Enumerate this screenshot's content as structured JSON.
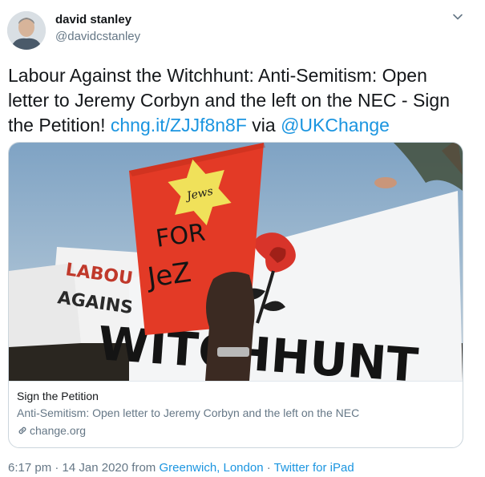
{
  "user": {
    "name": "david stanley",
    "handle": "@davidcstanley"
  },
  "tweet": {
    "text_plain": "Labour Against the Witchhunt: Anti-Semitism: Open letter to Jeremy Corbyn and the left on the NEC - Sign the Petition!",
    "link": "chng.it/ZJJf8n8F",
    "via_word": "via",
    "mention": "@UKChange"
  },
  "card": {
    "image_alt": "Protest placard reading Jews For Jez in front of a Witchhunt banner",
    "image_text": {
      "star": "Jews",
      "placard_line1": "FOR",
      "placard_line2": "JeZ",
      "banner_left": "LABOUR AGAINST",
      "banner_main": "WITCHHUNT"
    },
    "title": "Sign the Petition",
    "description": "Anti-Semitism: Open letter to Jeremy Corbyn and the left on the NEC",
    "domain": "change.org"
  },
  "meta": {
    "time": "6:17 pm",
    "sep1": " · ",
    "date": "14 Jan 2020",
    "from_word": " from ",
    "location": "Greenwich, London",
    "sep2": " · ",
    "source": "Twitter for iPad"
  },
  "icons": {
    "caret": "chevron-down-icon",
    "link": "link-icon"
  },
  "colors": {
    "link": "#1b95e0",
    "secondary": "#657786",
    "border": "#ccd6dd"
  }
}
